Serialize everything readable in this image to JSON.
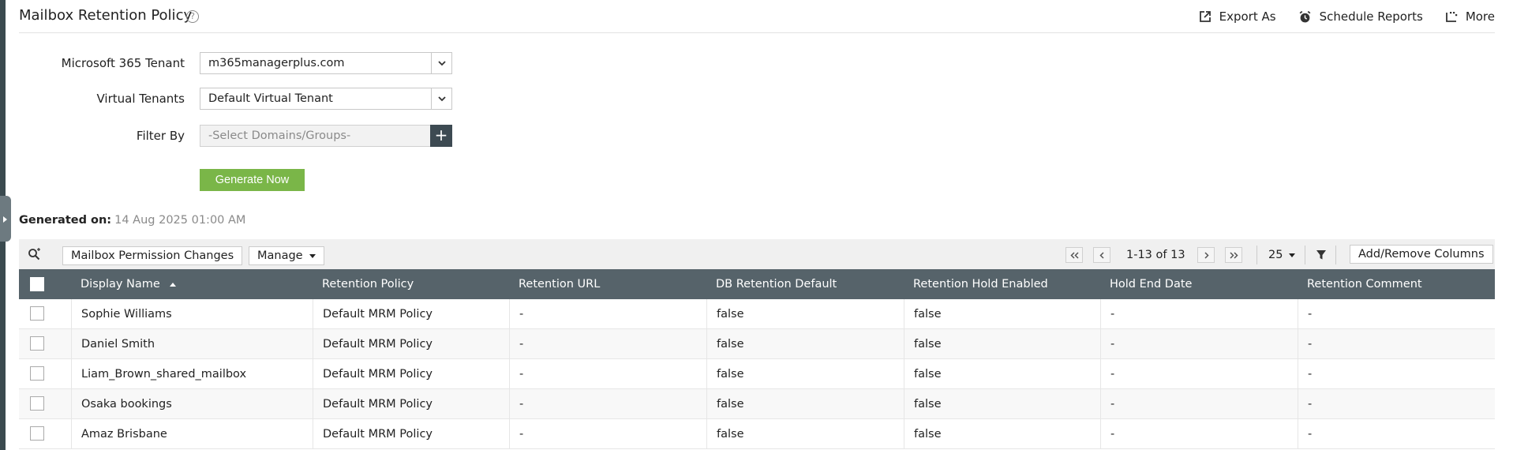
{
  "header": {
    "title": "Mailbox Retention Policy",
    "help_icon": "question-circle-icon",
    "actions": [
      {
        "label": "Export As",
        "icon": "export-icon"
      },
      {
        "label": "Schedule Reports",
        "icon": "alarm-clock-icon"
      },
      {
        "label": "More",
        "icon": "more-icon"
      }
    ]
  },
  "form": {
    "tenant_label": "Microsoft 365 Tenant",
    "tenant_value": "m365managerplus.com",
    "virtual_label": "Virtual Tenants",
    "virtual_value": "Default Virtual Tenant",
    "filter_label": "Filter By",
    "filter_placeholder": "-Select Domains/Groups-",
    "generate_label": "Generate Now"
  },
  "generated": {
    "label": "Generated on:",
    "value": "14 Aug 2025 01:00 AM"
  },
  "toolbar": {
    "view_label": "Mailbox Permission Changes",
    "manage_label": "Manage",
    "pager_text": "1-13 of 13",
    "page_size": "25",
    "columns_label": "Add/Remove Columns"
  },
  "table": {
    "columns": [
      "Display Name",
      "Retention Policy",
      "Retention URL",
      "DB Retention Default",
      "Retention Hold Enabled",
      "Hold End Date",
      "Retention Comment"
    ],
    "rows": [
      [
        "Sophie Williams",
        "Default MRM Policy",
        "-",
        "false",
        "false",
        "-",
        "-"
      ],
      [
        "Daniel Smith",
        "Default MRM Policy",
        "-",
        "false",
        "false",
        "-",
        "-"
      ],
      [
        "Liam_Brown_shared_mailbox",
        "Default MRM Policy",
        "-",
        "false",
        "false",
        "-",
        "-"
      ],
      [
        "Osaka bookings",
        "Default MRM Policy",
        "-",
        "false",
        "false",
        "-",
        "-"
      ],
      [
        "Amaz Brisbane",
        "Default MRM Policy",
        "-",
        "false",
        "false",
        "-",
        "-"
      ]
    ]
  },
  "colors": {
    "header_bg": "#56636a",
    "primary_button": "#7ab648",
    "toolbar_bg": "#f0f0f0"
  }
}
